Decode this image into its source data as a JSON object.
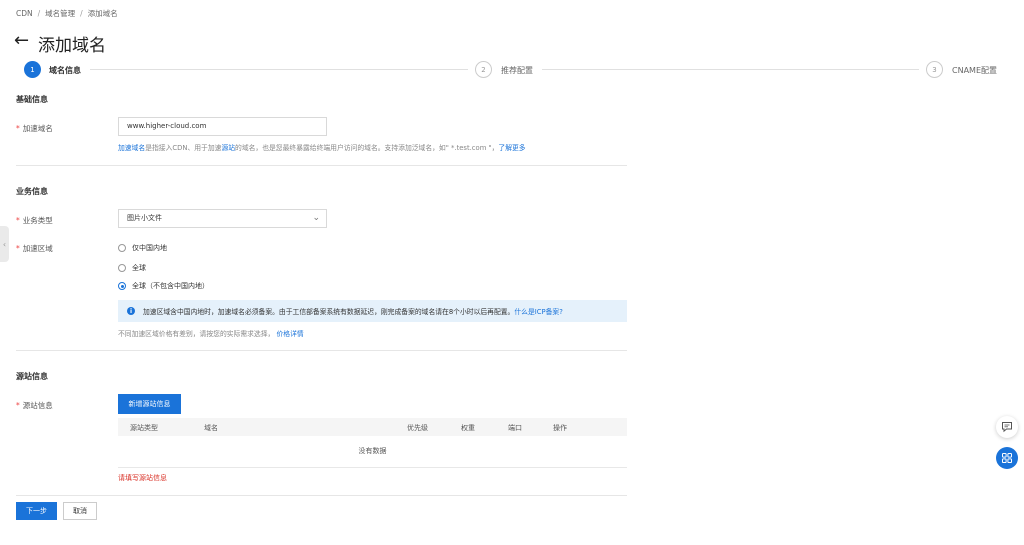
{
  "breadcrumb": [
    "CDN",
    "域名管理",
    "添加域名"
  ],
  "page_title": "添加域名",
  "steps": [
    {
      "num": "1",
      "label": "域名信息"
    },
    {
      "num": "2",
      "label": "推荐配置"
    },
    {
      "num": "3",
      "label": "CNAME配置"
    }
  ],
  "basic": {
    "section": "基础信息",
    "domain_label": "加速域名",
    "domain_value": "www.higher-cloud.com",
    "hint_link1": "加速域名",
    "hint_text1": "是指接入CDN、用于加速",
    "hint_link2": "源站",
    "hint_text2": "的域名，也是您最终暴露给终端用户访问的域名。支持添加泛域名，如\" *.test.com \"，",
    "hint_more": "了解更多"
  },
  "business": {
    "section": "业务信息",
    "type_label": "业务类型",
    "type_value": "图片小文件",
    "region_label": "加速区域",
    "regions": [
      "仅中国内地",
      "全球",
      "全球（不包含中国内地）"
    ],
    "selected_region": 2,
    "info_text": "加速区域含中国内地时，加速域名必须备案。由于工信部备案系统有数据延迟，刚完成备案的域名请在8个小时以后再配置。",
    "info_link": "什么是ICP备案?",
    "price_hint": "不同加速区域价格有差别，请按您的实际需求选择，",
    "price_link": "价格详情"
  },
  "origin": {
    "section": "源站信息",
    "label": "源站信息",
    "add_button": "新增源站信息",
    "columns": [
      "源站类型",
      "域名",
      "优先级",
      "权重",
      "端口",
      "操作"
    ],
    "empty": "没有数据",
    "error": "请填写源站信息"
  },
  "footer": {
    "next": "下一步",
    "cancel": "取消"
  },
  "colors": {
    "accent": "#1a73d9",
    "error": "#d93026",
    "required": "#e44444"
  },
  "icons": {
    "back": "arrow-left-icon",
    "collapse": "chevron-left-icon",
    "chat": "chat-icon",
    "apps": "grid-icon",
    "dropdown": "chevron-down-icon",
    "info": "info-icon"
  }
}
